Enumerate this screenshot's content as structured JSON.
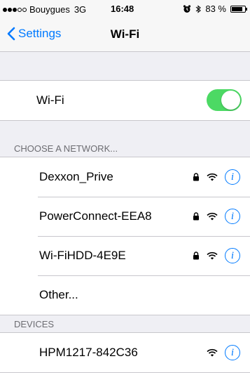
{
  "status_bar": {
    "carrier": "Bouygues",
    "network": "3G",
    "time": "16:48",
    "battery": "83 %",
    "battery_level": 0.83,
    "signal_bars": 3,
    "signal_max": 5
  },
  "nav": {
    "back_label": "Settings",
    "title": "Wi-Fi"
  },
  "wifi_row": {
    "label": "Wi-Fi",
    "enabled": true
  },
  "networks_header": "CHOOSE A NETWORK...",
  "networks": [
    {
      "name": "Dexxon_Prive",
      "locked": true
    },
    {
      "name": "PowerConnect-EEA8",
      "locked": true
    },
    {
      "name": "Wi-FiHDD-4E9E",
      "locked": true
    }
  ],
  "other_label": "Other...",
  "devices_header": "DEVICES",
  "devices": [
    {
      "name": "HPM1217-842C36",
      "locked": false
    }
  ],
  "colors": {
    "accent": "#007aff",
    "toggle_on": "#4cd964"
  },
  "icons": {
    "back": "chevron-left-icon",
    "lock": "lock-icon",
    "wifi": "wifi-icon",
    "info": "info-icon",
    "alarm": "alarm-icon",
    "bluetooth": "bluetooth-icon"
  }
}
